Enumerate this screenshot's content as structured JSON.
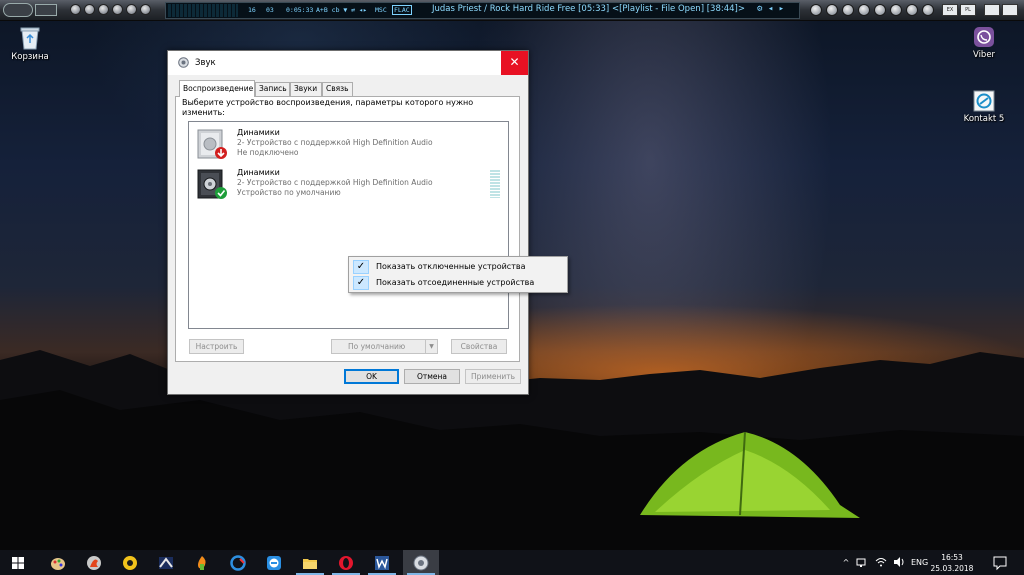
{
  "player": {
    "lcd_a": "16",
    "lcd_b": "03",
    "lcd_time": "0:05:33",
    "lcd_flags": "A+B  cb  ▼  ⇄   ◂▸",
    "lcd_fmt": "MSC",
    "lcd_badge": "FLAC",
    "now_playing": "Judas Priest / Rock Hard Ride Free  [05:33]    <[Playlist - File Open]  [38:44]>",
    "btn_ex": "EX",
    "btn_pl": "PL"
  },
  "desktop": {
    "icons": [
      {
        "label": "Корзина",
        "icon": "recycle-bin-icon"
      },
      {
        "label": "Viber",
        "icon": "viber-icon"
      },
      {
        "label": "Kontakt 5",
        "icon": "kontakt-icon"
      }
    ]
  },
  "dialog": {
    "title": "Звук",
    "close_glyph": "✕",
    "tabs": [
      {
        "label": "Воспроизведение",
        "active": true
      },
      {
        "label": "Запись",
        "active": false
      },
      {
        "label": "Звуки",
        "active": false
      },
      {
        "label": "Связь",
        "active": false
      }
    ],
    "instruction": "Выберите устройство воспроизведения, параметры которого нужно изменить:",
    "devices": [
      {
        "name": "Динамики",
        "description": "2- Устройство с поддержкой High Definition Audio",
        "status": "Не подключено",
        "state": "disconnected"
      },
      {
        "name": "Динамики",
        "description": "2- Устройство с поддержкой High Definition Audio",
        "status": "Устройство по умолчанию",
        "state": "default"
      }
    ],
    "buttons": {
      "configure": "Настроить",
      "set_default": "По умолчанию",
      "set_default_arrow": "▼",
      "properties": "Свойства",
      "ok": "OK",
      "cancel": "Отмена",
      "apply": "Применить"
    }
  },
  "context_menu": {
    "items": [
      {
        "label": "Показать отключенные устройства",
        "checked": true,
        "check_glyph": "✓"
      },
      {
        "label": "Показать отсоединенные устройства",
        "checked": true,
        "check_glyph": "✓"
      }
    ]
  },
  "taskbar": {
    "apps": [
      {
        "icon": "windows-start-icon",
        "active": false
      },
      {
        "icon": "app-paint-icon",
        "active": false
      },
      {
        "icon": "app-burn-icon",
        "active": false
      },
      {
        "icon": "app-yellow-icon",
        "active": false
      },
      {
        "icon": "app-winamp-icon",
        "active": false
      },
      {
        "icon": "app-fl-studio-icon",
        "active": false
      },
      {
        "icon": "app-ccleaner-icon",
        "active": false
      },
      {
        "icon": "app-teamviewer-icon",
        "active": false
      },
      {
        "icon": "file-explorer-icon",
        "active": false
      },
      {
        "icon": "opera-icon",
        "active": false
      },
      {
        "icon": "word-icon",
        "active": false
      },
      {
        "icon": "sound-app-icon",
        "active": true
      }
    ],
    "tray": {
      "chevron": "^",
      "language": "ENG",
      "time": "16:53",
      "date": "25.03.2018"
    }
  },
  "colors": {
    "close_red": "#e81123",
    "accent": "#0078d7",
    "default_green": "#1e9e3a",
    "disconnect_red": "#d21f1f"
  }
}
